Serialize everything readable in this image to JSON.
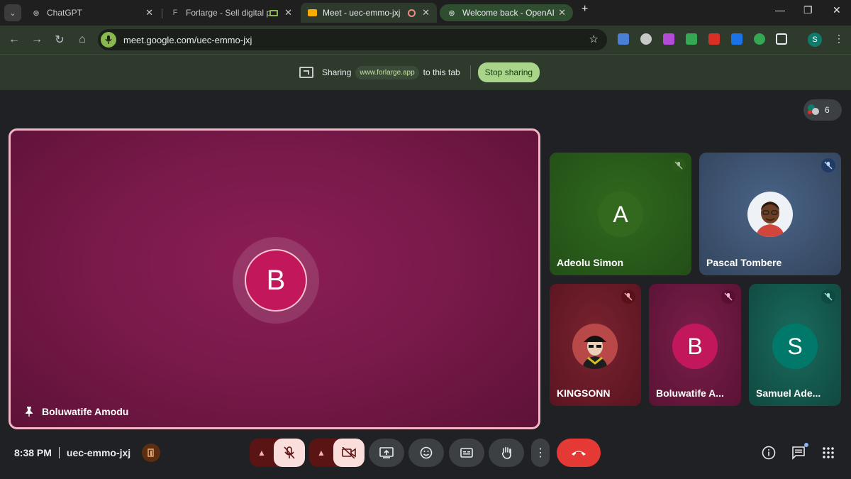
{
  "browser": {
    "tabs": [
      {
        "title": "ChatGPT",
        "favicon": "openai-icon"
      },
      {
        "title": "Forlarge - Sell digital pro",
        "favicon": "forlarge-icon"
      },
      {
        "title": "Meet - uec-emmo-jxj",
        "favicon": "meet-icon"
      },
      {
        "title": "Welcome back - OpenAI",
        "favicon": "openai-icon"
      }
    ],
    "url": "meet.google.com/uec-emmo-jxj",
    "profile_initial": "S",
    "new_tab_label": "+"
  },
  "sharebar": {
    "sharing_label": "Sharing",
    "domain": "www.forlarge.app",
    "suffix": "to this tab",
    "stop_button": "Stop sharing"
  },
  "meet": {
    "participant_count": "6",
    "main": {
      "name": "Boluwatife Amodu",
      "initial": "B",
      "color": "#c2185b"
    },
    "tiles": [
      {
        "name": "Adeolu Simon",
        "initial": "A",
        "bg": "#2e5a1c",
        "avatar_color": "#33691e",
        "muted": true
      },
      {
        "name": "Pascal Tombere",
        "initial": "",
        "bg": "#3a4f6b",
        "avatar": "photo",
        "muted": true
      },
      {
        "name": "KINGSONN",
        "initial": "",
        "bg": "#6b1a28",
        "avatar": "photo",
        "muted": true
      },
      {
        "name": "Boluwatife A...",
        "initial": "B",
        "bg": "#6b1a3c",
        "avatar_color": "#c2185b",
        "muted": true
      },
      {
        "name": "Samuel Ade...",
        "initial": "S",
        "bg": "#145a4e",
        "avatar_color": "#00796b",
        "muted": true
      }
    ],
    "time": "8:38 PM",
    "meeting_code": "uec-emmo-jxj"
  }
}
